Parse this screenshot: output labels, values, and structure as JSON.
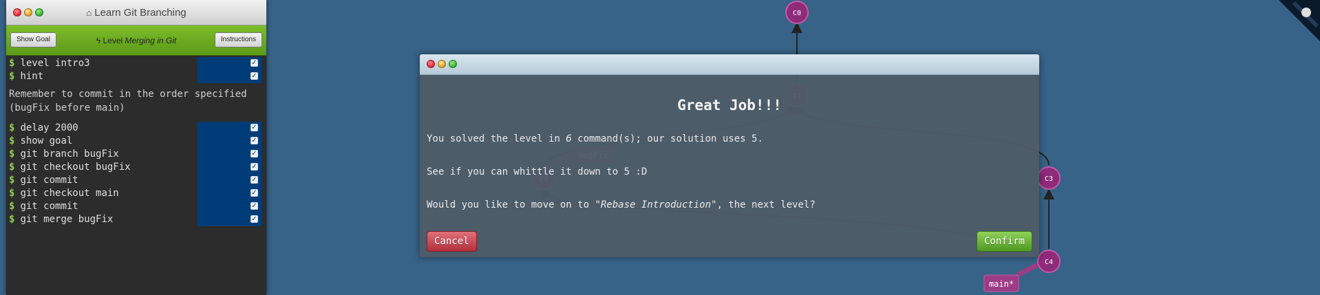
{
  "terminal": {
    "title": "Learn Git Branching",
    "title_icon": "home-icon",
    "show_goal_label": "Show Goal",
    "instructions_label": "Instructions",
    "level_prefix": "Level",
    "level_name": "Merging in Git",
    "commands_top": [
      "level intro3",
      "hint"
    ],
    "note": "Remember to commit in the order specified (bugFix before main)",
    "commands_bottom": [
      "delay 2000",
      "show goal",
      "git branch bugFix",
      "git checkout bugFix",
      "git commit",
      "git checkout main",
      "git commit",
      "git merge bugFix"
    ],
    "prompt": "$",
    "check_glyph": "✓"
  },
  "graph": {
    "commits": [
      "C0",
      "C1",
      "C2",
      "C3",
      "C4"
    ],
    "branches": [
      "bugFix",
      "main*"
    ],
    "colors": {
      "commit_fill": "#8e2b7a",
      "commit_stroke": "#c55aa9",
      "branch_fill": "#9b3c85",
      "background": "#376388"
    }
  },
  "modal": {
    "heading": "Great Job!!!",
    "line1_pre": "You solved the level in ",
    "line1_count": "6",
    "line1_post": " command(s); our solution uses 5.",
    "line2": "See if you can whittle it down to 5 :D",
    "line3_pre": "Would you like to move on to ",
    "line3_level": "\"Rebase Introduction\"",
    "line3_post": ", the next level?",
    "cancel_label": "Cancel",
    "confirm_label": "Confirm"
  }
}
